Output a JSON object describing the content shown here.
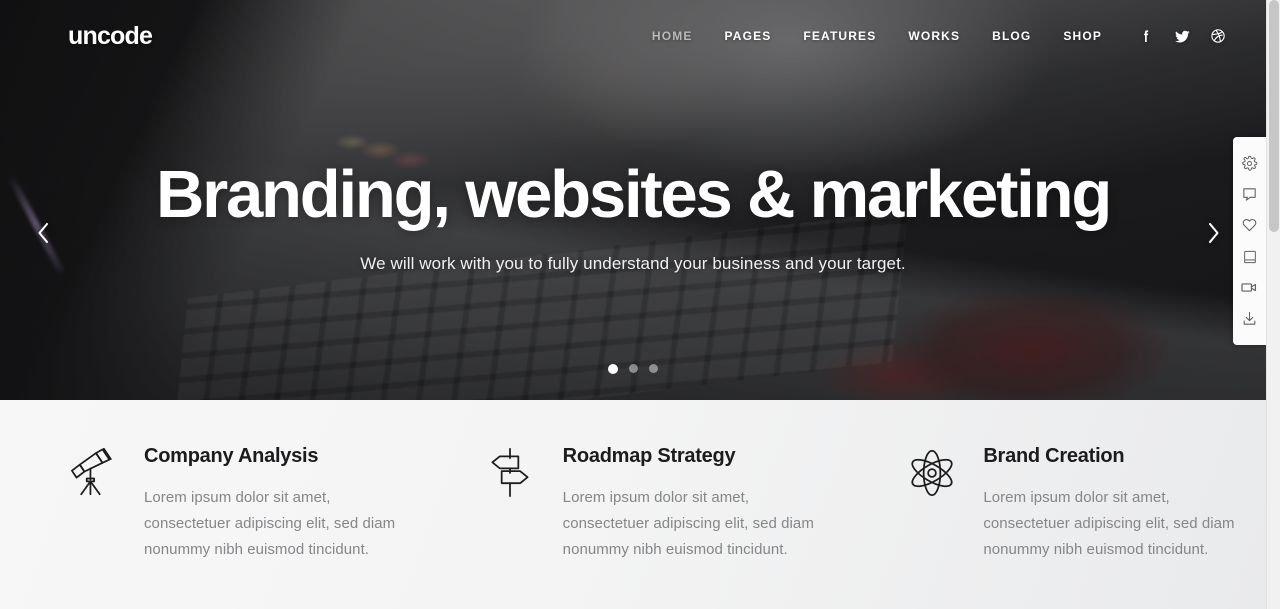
{
  "site": {
    "logo": "uncode"
  },
  "nav": {
    "items": [
      {
        "label": "HOME",
        "active": true
      },
      {
        "label": "PAGES",
        "active": false
      },
      {
        "label": "FEATURES",
        "active": false
      },
      {
        "label": "WORKS",
        "active": false
      },
      {
        "label": "BLOG",
        "active": false
      },
      {
        "label": "SHOP",
        "active": false
      }
    ],
    "social": [
      {
        "name": "facebook-icon"
      },
      {
        "name": "twitter-icon"
      },
      {
        "name": "dribbble-icon"
      }
    ]
  },
  "hero": {
    "title": "Branding, websites & marketing",
    "subtitle": "We will work with you to fully understand your business and your target.",
    "prev_arrow": "‹",
    "next_arrow": "›",
    "slides": 3,
    "active_slide": 1
  },
  "side_panel": {
    "items": [
      {
        "name": "gear-icon",
        "label": "Settings"
      },
      {
        "name": "speech-bubble-icon",
        "label": "Comments"
      },
      {
        "name": "heart-icon",
        "label": "Favorites"
      },
      {
        "name": "book-icon",
        "label": "Documentation"
      },
      {
        "name": "video-camera-icon",
        "label": "Videos"
      },
      {
        "name": "download-icon",
        "label": "Download"
      }
    ]
  },
  "features": [
    {
      "icon": "telescope-icon",
      "title": "Company Analysis",
      "text": "Lorem ipsum dolor sit amet, consectetuer adipiscing elit, sed diam nonummy nibh euismod tincidunt."
    },
    {
      "icon": "signpost-icon",
      "title": "Roadmap Strategy",
      "text": "Lorem ipsum dolor sit amet, consectetuer adipiscing elit, sed diam nonummy nibh euismod tincidunt."
    },
    {
      "icon": "atom-icon",
      "title": "Brand Creation",
      "text": "Lorem ipsum dolor sit amet, consectetuer adipiscing elit, sed diam nonummy nibh euismod tincidunt."
    }
  ],
  "colors": {
    "accent_text": "#ffffff",
    "nav_active": "#b9b9b9",
    "feature_title": "#1c1c1e",
    "feature_body": "#848689",
    "features_bg": "#f4f4f4"
  }
}
